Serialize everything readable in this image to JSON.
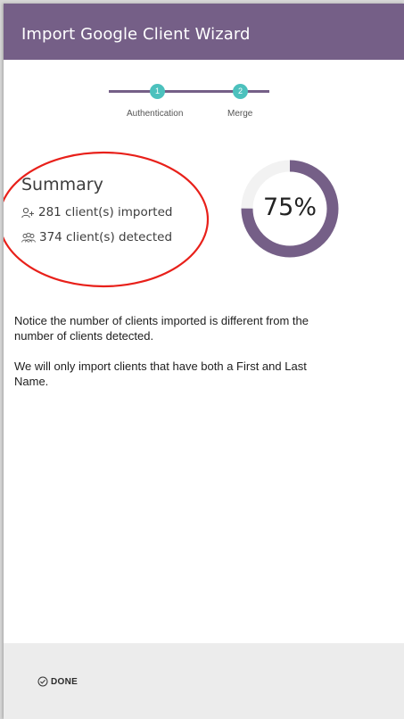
{
  "header": {
    "title": "Import Google Client Wizard"
  },
  "stepper": {
    "steps": [
      {
        "number": "1",
        "label": "Authentication"
      },
      {
        "number": "2",
        "label": "Merge"
      }
    ]
  },
  "summary": {
    "title": "Summary",
    "imported": "281 client(s) imported",
    "detected": "374 client(s) detected",
    "imported_icon": "user-plus-icon",
    "detected_icon": "users-group-icon"
  },
  "progress": {
    "percent": 75,
    "label": "75%",
    "color": "#755f87",
    "track_color": "#f2f2f2"
  },
  "notice": {
    "line1": "Notice the number of clients imported is different from the number of clients detected.",
    "line2": "We will only import clients that have both a First and Last Name."
  },
  "footer": {
    "done_label": "DONE",
    "done_icon": "check-circle-icon"
  },
  "colors": {
    "header_bg": "#755f87",
    "step_dot": "#4cc1bd",
    "annotation": "#e8201a"
  }
}
